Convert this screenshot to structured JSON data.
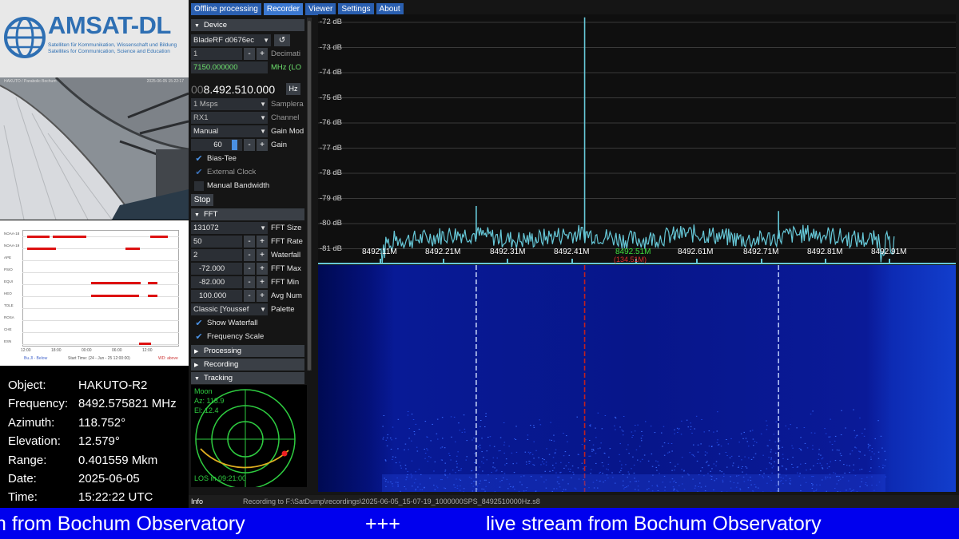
{
  "logo": {
    "title": "AMSAT-DL",
    "sub1": "Satelliten für Kommunikation, Wissenschaft und Bildung",
    "sub2": "Satellites for Communication, Science and Education"
  },
  "camera": {
    "label": "HAKUTO / Parabolic Bochum",
    "time": "2025-06-05 15:22:17"
  },
  "schedule": {
    "rows": [
      "NOAA-18",
      "NOAA-19",
      "APE",
      "PSIO",
      "EQUI",
      "HEO",
      "TOLE",
      "ROSA",
      "CHE",
      "ESN"
    ],
    "ticks": [
      "12:00",
      "18:00",
      "00:00",
      "06:00",
      "12:00"
    ],
    "foot_left": "Bu.Jl - Below",
    "foot_mid": "Start Time: (24 - Jun - 25 12:00:00)",
    "foot_right": "WD: above"
  },
  "info": {
    "object_label": "Object:",
    "object": "HAKUTO-R2",
    "frequency_label": "Frequency:",
    "frequency": "8492.575821 MHz",
    "azimuth_label": "Azimuth:",
    "azimuth": "118.752°",
    "elevation_label": "Elevation:",
    "elevation": "12.579°",
    "range_label": "Range:",
    "range": "0.401559 Mkm",
    "date_label": "Date:",
    "date": "2025-06-05",
    "time_label": "Time:",
    "time": "15:22:22 UTC"
  },
  "menu": [
    "Offline processing",
    "Recorder",
    "Viewer",
    "Settings",
    "About"
  ],
  "panel": {
    "device_header": "Device",
    "device_select": "BladeRF d0676ec",
    "decim_value": "1",
    "decim_label": "Decimati",
    "lo_value": "7150.000000",
    "lo_label": "MHz (LO",
    "freq_dim": "00",
    "freq_main": "8.492.510.000",
    "hz_label": "Hz",
    "samplerate_value": "1 Msps",
    "samplerate_label": "Samplera",
    "channel_value": "RX1",
    "channel_label": "Channel",
    "gain_mode_value": "Manual",
    "gain_mode_label": "Gain Mod",
    "gain_value": "60",
    "gain_label": "Gain",
    "bias_tee": "Bias-Tee",
    "ext_clock": "External Clock",
    "manual_bw": "Manual Bandwidth",
    "stop": "Stop",
    "fft_header": "FFT",
    "fft_size_value": "131072",
    "fft_size_label": "FFT Size",
    "fft_rate_value": "50",
    "fft_rate_label": "FFT Rate",
    "waterfall_value": "2",
    "waterfall_label": "Waterfall",
    "fft_max_value": "-72.000",
    "fft_max_label": "FFT Max",
    "fft_min_value": "-82.000",
    "fft_min_label": "FFT Min",
    "avg_value": "100.000",
    "avg_label": "Avg Num",
    "palette_value": "Classic [Youssef",
    "palette_label": "Palette",
    "show_waterfall": "Show Waterfall",
    "freq_scale": "Frequency Scale",
    "processing_header": "Processing",
    "recording_header": "Recording",
    "tracking_header": "Tracking",
    "minus": "-",
    "plus": "+"
  },
  "tracking": {
    "name": "Moon",
    "az": "Az: 118.9",
    "el": "El: 12.4",
    "los": "LOS in 09:21:00"
  },
  "statusbar": {
    "tab": "Info",
    "status": "Recording to F:\\SatDump\\recordings\\2025-06-05_15-07-19_1000000SPS_8492510000Hz.s8"
  },
  "spectrum": {
    "db_labels": [
      "-72 dB",
      "-73 dB",
      "-74 dB",
      "-75 dB",
      "-76 dB",
      "-77 dB",
      "-78 dB",
      "-79 dB",
      "-80 dB",
      "-81 dB"
    ],
    "freq_labels": [
      "8492.11M",
      "8492.21M",
      "8492.31M",
      "8492.41M",
      "8492.61M",
      "8492.71M",
      "8492.81M",
      "8492.91M"
    ],
    "center_label": "8492.51M",
    "center_sub": "(134.51M)",
    "db_max": -72,
    "db_min": -82,
    "f_start": 8492.01,
    "f_end": 8493.01,
    "peaks_mhz": [
      8492.258,
      8492.428,
      8492.732,
      8492.568
    ],
    "peaks_db": [
      -79.3,
      -71.8,
      -79.5,
      -80.5
    ],
    "colors": {
      "trace": "#66c8d8",
      "grid": "#3a3a3a",
      "accent": "#2ecc40"
    }
  },
  "ticker": {
    "left": "n from Bochum Observatory",
    "mid": "+++",
    "right": "live stream from Bochum Observatory"
  }
}
